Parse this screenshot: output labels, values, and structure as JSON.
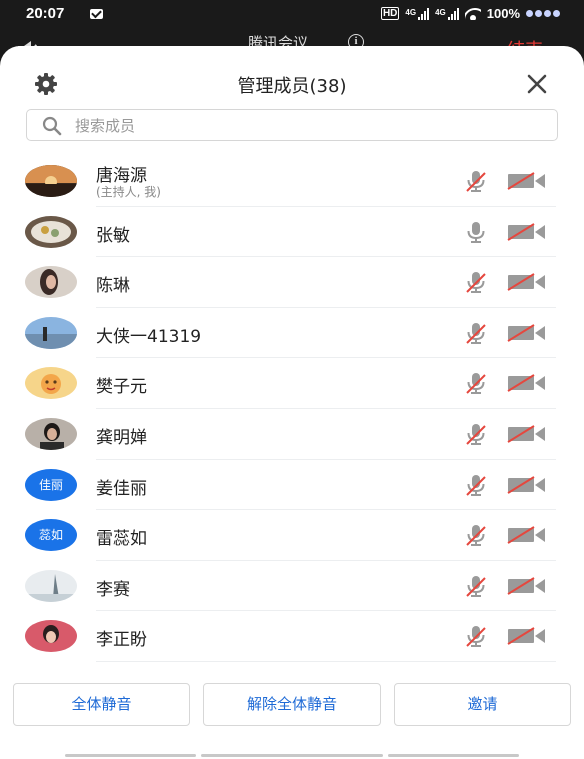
{
  "status_bar": {
    "time": "20:07",
    "hd": "HD",
    "net1": "4G",
    "net2": "4G",
    "battery": "100%"
  },
  "meeting_bar": {
    "title": "腾讯会议",
    "info": "i",
    "end": "结束"
  },
  "panel": {
    "title": "管理成员(38)",
    "search_placeholder": "搜索成员"
  },
  "members": [
    {
      "name": "唐海源",
      "subtitle": "(主持人, 我)",
      "avatar": "photo-sunset",
      "mic_muted": true,
      "camera_off": true
    },
    {
      "name": "张敏",
      "subtitle": "",
      "avatar": "photo-food",
      "mic_muted": false,
      "camera_off": true
    },
    {
      "name": "陈琳",
      "subtitle": "",
      "avatar": "photo-girl",
      "mic_muted": true,
      "camera_off": true
    },
    {
      "name": "大侠一41319",
      "subtitle": "",
      "avatar": "photo-beach",
      "mic_muted": true,
      "camera_off": true
    },
    {
      "name": "樊子元",
      "subtitle": "",
      "avatar": "photo-cartoon",
      "mic_muted": true,
      "camera_off": true
    },
    {
      "name": "龚明婵",
      "subtitle": "",
      "avatar": "photo-boy",
      "mic_muted": true,
      "camera_off": true
    },
    {
      "name": "姜佳丽",
      "subtitle": "",
      "avatar_text": "佳丽",
      "mic_muted": true,
      "camera_off": true
    },
    {
      "name": "雷蕊如",
      "subtitle": "",
      "avatar_text": "蕊如",
      "mic_muted": true,
      "camera_off": true
    },
    {
      "name": "李赛",
      "subtitle": "",
      "avatar": "photo-snow",
      "mic_muted": true,
      "camera_off": true
    },
    {
      "name": "李正盼",
      "subtitle": "",
      "avatar": "photo-portrait",
      "mic_muted": true,
      "camera_off": true
    }
  ],
  "footer": {
    "mute_all": "全体静音",
    "unmute_all": "解除全体静音",
    "invite": "邀请"
  },
  "colors": {
    "accent": "#1e6ad6",
    "avatar_text_bg": "#1a73e8",
    "mute_slash": "#e5473e",
    "icon_gray": "#9a9a9a",
    "end_red": "#e53935"
  },
  "icons": {
    "settings": "gear-icon",
    "close": "close-icon",
    "search": "search-icon",
    "mic": "microphone-icon",
    "camera": "video-camera-icon",
    "speaker": "speaker-icon",
    "info": "info-icon"
  }
}
